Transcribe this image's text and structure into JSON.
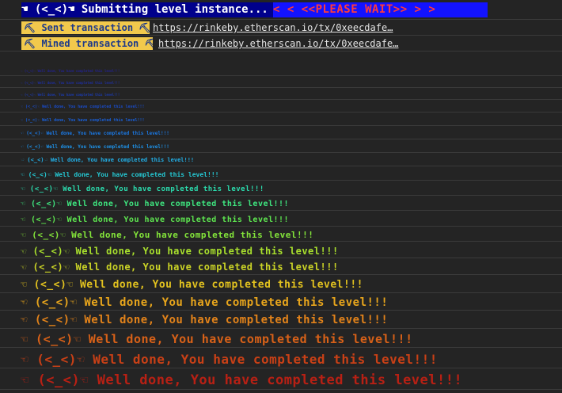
{
  "banner": {
    "left_text": "☚ (<_<)☚ Submitting level instance...",
    "right_text": "<  < <<PLEASE WAIT>> >  >"
  },
  "transactions": [
    {
      "label": "⛏ Sent transaction ⛏",
      "url": "https://rinkeby.etherscan.io/tx/0xeecdafe…"
    },
    {
      "label": "⛏ Mined transaction ⛏",
      "url": "https://rinkeby.etherscan.io/tx/0xeecdafe…"
    }
  ],
  "messages": [
    {
      "text": "☜ (<_<)☜ Well done, You have completed this level!!!",
      "color": "#23238f"
    },
    {
      "text": "☜ (<_<)☜ Well done, You have completed this level!!!",
      "color": "#1f2fa0"
    },
    {
      "text": "☜ (<_<)☜ Well done, You have completed this level!!!",
      "color": "#1c3bb2"
    },
    {
      "text": "☜ (<_<)☜ Well done, You have completed this level!!!",
      "color": "#1a4ac4"
    },
    {
      "text": "☜ (<_<)☜ Well done, You have completed this level!!!",
      "color": "#1a5fd6"
    },
    {
      "text": "☜ (<_<)☜ Well done, You have completed this level!!!",
      "color": "#1a78e3"
    },
    {
      "text": "☜ (<_<)☜ Well done, You have completed this level!!!",
      "color": "#1e93ea"
    },
    {
      "text": "☜ (<_<)☜ Well done, You have completed this level!!!",
      "color": "#22b0e8"
    },
    {
      "text": "☜ (<_<)☜ Well done, You have completed this level!!!",
      "color": "#25c9d4"
    },
    {
      "text": "☜ (<_<)☜ Well done, You have completed this level!!!",
      "color": "#2bdcae"
    },
    {
      "text": "☜ (<_<)☜ Well done, You have completed this level!!!",
      "color": "#3ee57f"
    },
    {
      "text": "☜ (<_<)☜ Well done, You have completed this level!!!",
      "color": "#5ee750"
    },
    {
      "text": "☜ (<_<)☜ Well done, You have completed this level!!!",
      "color": "#84e63a"
    },
    {
      "text": "☜ (<_<)☜ Well done, You have completed this level!!!",
      "color": "#a9e02d"
    },
    {
      "text": "☜ (<_<)☜ Well done, You have completed this level!!!",
      "color": "#cbd426"
    },
    {
      "text": "☜ (<_<)☜ Well done, You have completed this level!!!",
      "color": "#e2c21f"
    },
    {
      "text": "☜ (<_<)☜ Well done, You have completed this level!!!",
      "color": "#e9a61c"
    },
    {
      "text": "☜ (<_<)☜ Well done, You have completed this level!!!",
      "color": "#e3831a"
    },
    {
      "text": "☜ (<_<)☜ Well done, You have completed this level!!!",
      "color": "#d86118"
    },
    {
      "text": "☜ (<_<)☜ Well done, You have completed this level!!!",
      "color": "#c94016"
    },
    {
      "text": "☜ (<_<)☜ Well done, You have completed this level!!!",
      "color": "#b82014"
    }
  ]
}
